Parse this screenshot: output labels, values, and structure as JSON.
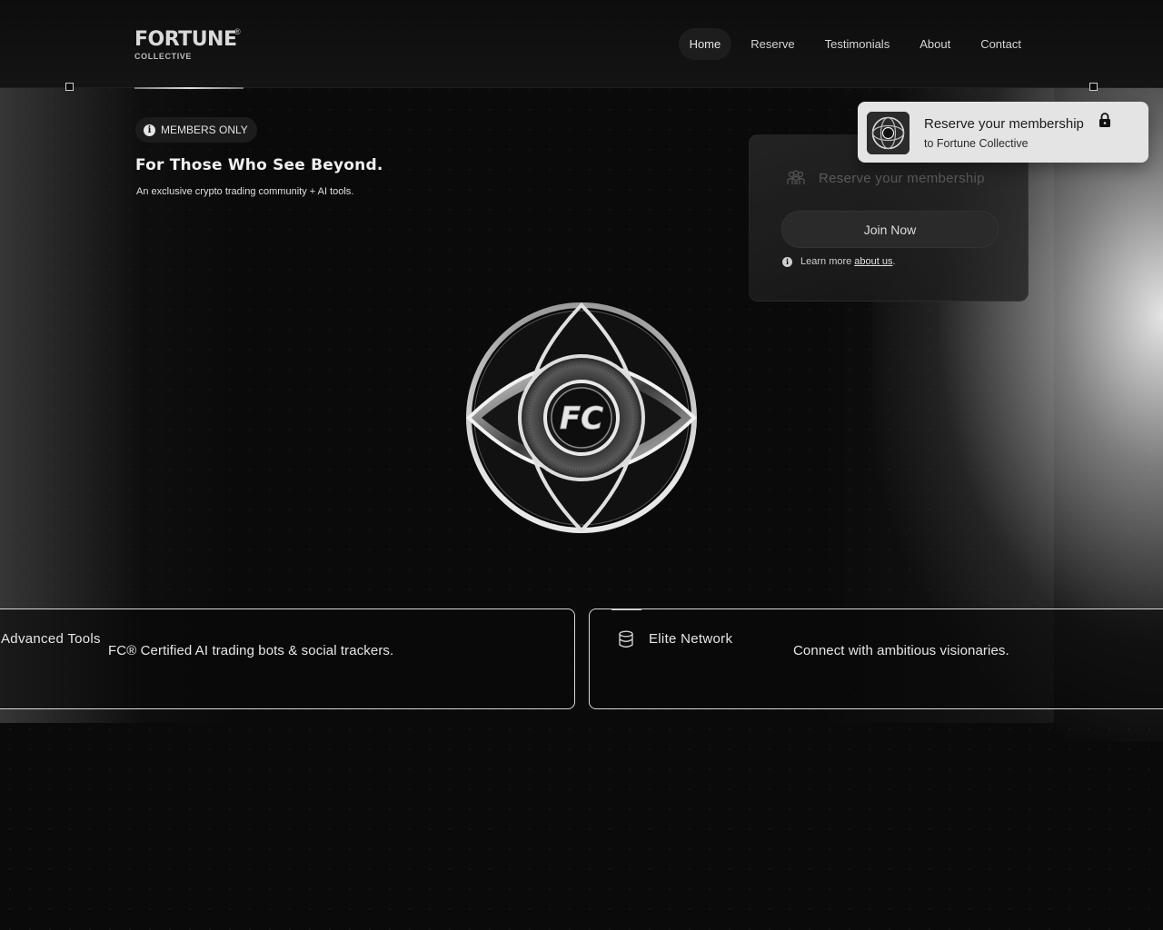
{
  "brand": {
    "name": "FORTUNE",
    "registered": "®",
    "sub": "COLLECTIVE"
  },
  "nav": {
    "items": [
      {
        "label": "Home",
        "active": true
      },
      {
        "label": "Reserve"
      },
      {
        "label": "Testimonials"
      },
      {
        "label": "About"
      },
      {
        "label": "Contact"
      }
    ]
  },
  "hero": {
    "badge": "MEMBERS ONLY",
    "title": "For Those Who See Beyond.",
    "subtitle": "An exclusive crypto trading community + AI tools."
  },
  "reserve_panel": {
    "input_placeholder": "Reserve your membership",
    "join_label": "Join Now",
    "learn_prefix": "Learn more",
    "learn_link": "about us",
    "learn_suffix": "."
  },
  "toast": {
    "title": "Reserve your membership",
    "subtitle": "to Fortune Collective",
    "icon": "lock-icon"
  },
  "emblem": {
    "monogram": "FC"
  },
  "features": [
    {
      "title": "Advanced Tools",
      "description": "FC® Certified AI trading bots & social trackers."
    },
    {
      "title": "Elite Network",
      "description": "Connect with ambitious visionaries.",
      "icon": "database-icon"
    }
  ],
  "colors": {
    "background": "#0a0a0a",
    "toast_bg": "#e4e4e4",
    "card_border": "#d8d8d8"
  }
}
